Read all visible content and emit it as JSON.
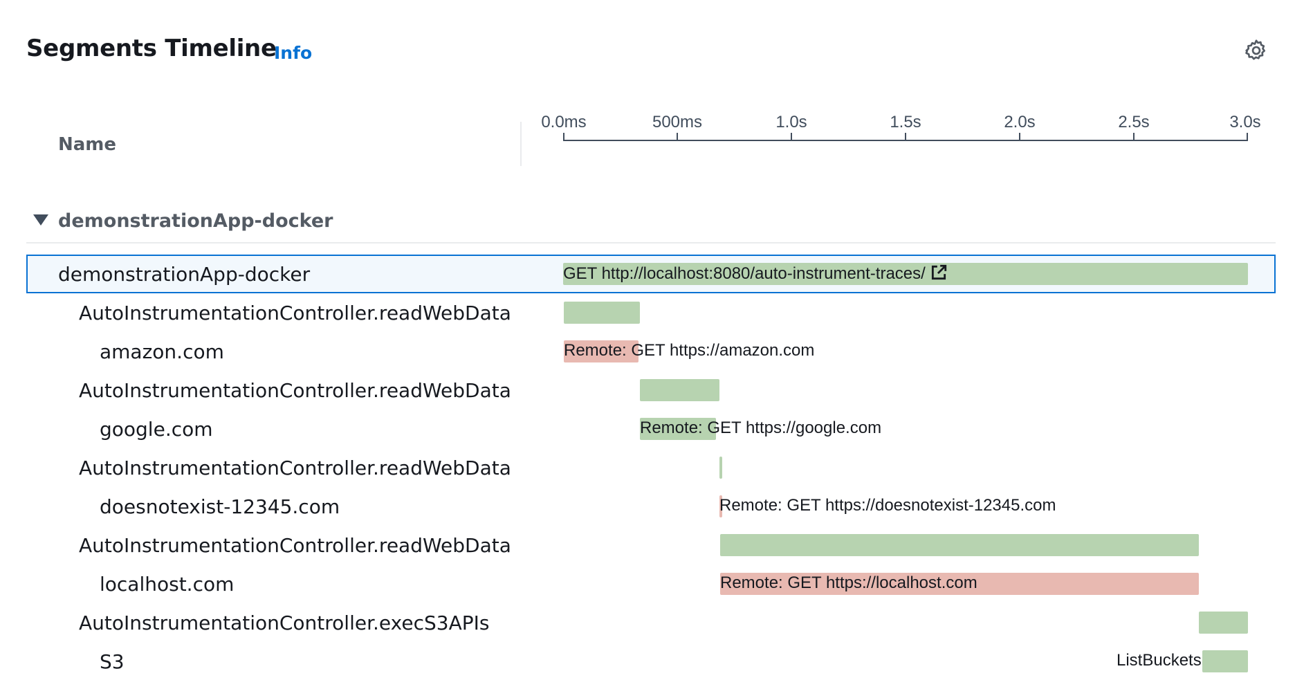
{
  "header": {
    "title": "Segments Timeline",
    "info_link": "Info",
    "settings_icon": "gear-icon"
  },
  "columns": {
    "name": "Name"
  },
  "axis": {
    "ticks": [
      "0.0ms",
      "500ms",
      "1.0s",
      "1.5s",
      "2.0s",
      "2.5s",
      "3.0s"
    ]
  },
  "group": {
    "label": "demonstrationApp-docker",
    "expanded": true
  },
  "colors": {
    "ok": "#b7d3b0",
    "error": "#e8b9b1",
    "selected_border": "#0972d3",
    "link": "#0972d3"
  },
  "rows": [
    {
      "name": "demonstrationApp-docker",
      "label": "GET http://localhost:8080/auto-instrument-traces/",
      "status": "ok",
      "selected": true,
      "external_link": true
    },
    {
      "name": "AutoInstrumentationController.readWebData",
      "label": "",
      "status": "ok"
    },
    {
      "name": "amazon.com",
      "label": "Remote: GET https://amazon.com",
      "status": "error"
    },
    {
      "name": "AutoInstrumentationController.readWebData",
      "label": "",
      "status": "ok"
    },
    {
      "name": "google.com",
      "label": "Remote: GET https://google.com",
      "status": "ok"
    },
    {
      "name": "AutoInstrumentationController.readWebData",
      "label": "",
      "status": "ok"
    },
    {
      "name": "doesnotexist-12345.com",
      "label": "Remote: GET https://doesnotexist-12345.com",
      "status": "error"
    },
    {
      "name": "AutoInstrumentationController.readWebData",
      "label": "",
      "status": "ok"
    },
    {
      "name": "localhost.com",
      "label": "Remote: GET https://localhost.com",
      "status": "error"
    },
    {
      "name": "AutoInstrumentationController.execS3APIs",
      "label": "",
      "status": "ok"
    },
    {
      "name": "S3",
      "label": "ListBuckets",
      "status": "ok"
    }
  ]
}
